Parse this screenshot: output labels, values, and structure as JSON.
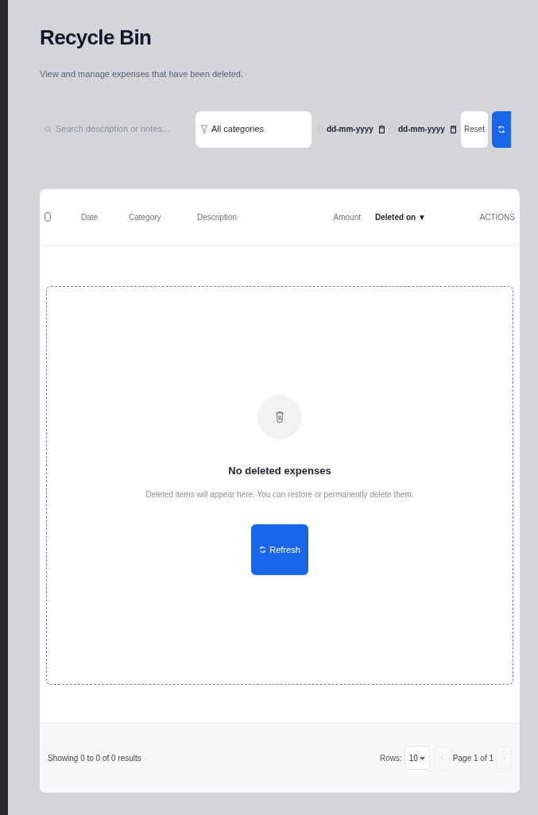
{
  "header": {
    "title": "Recycle Bin",
    "subtitle": "View and manage expenses that have been deleted."
  },
  "filters": {
    "search": {
      "placeholder": "Search description or notes..."
    },
    "category": {
      "value": "All categories"
    },
    "dates": [
      {
        "placeholder": "dd-mm-yyyy"
      },
      {
        "placeholder": "dd-mm-yyyy"
      }
    ],
    "reset": "Reset"
  },
  "table": {
    "select_all": {
      "checked": false
    },
    "columns": [
      {
        "label": "Date",
        "sorted": false
      },
      {
        "label": "Category",
        "sorted": false
      },
      {
        "label": "Description",
        "sorted": false
      },
      {
        "label": "Amount",
        "sorted": false
      },
      {
        "label": "Deleted on ▼",
        "sorted": true
      },
      {
        "label": "ACTIONS",
        "sorted": false
      }
    ],
    "empty": {
      "title": "No deleted expenses",
      "message": "Deleted items will appear here. You can restore or permanently delete them.",
      "button": "Refresh"
    },
    "footer": {
      "summary": "Showing 0 to 0 of 0 results",
      "rows_label": "Rows:",
      "rows_value": "10",
      "page": "Page 1 of 1",
      "prev_disabled": true,
      "next_disabled": true
    }
  }
}
